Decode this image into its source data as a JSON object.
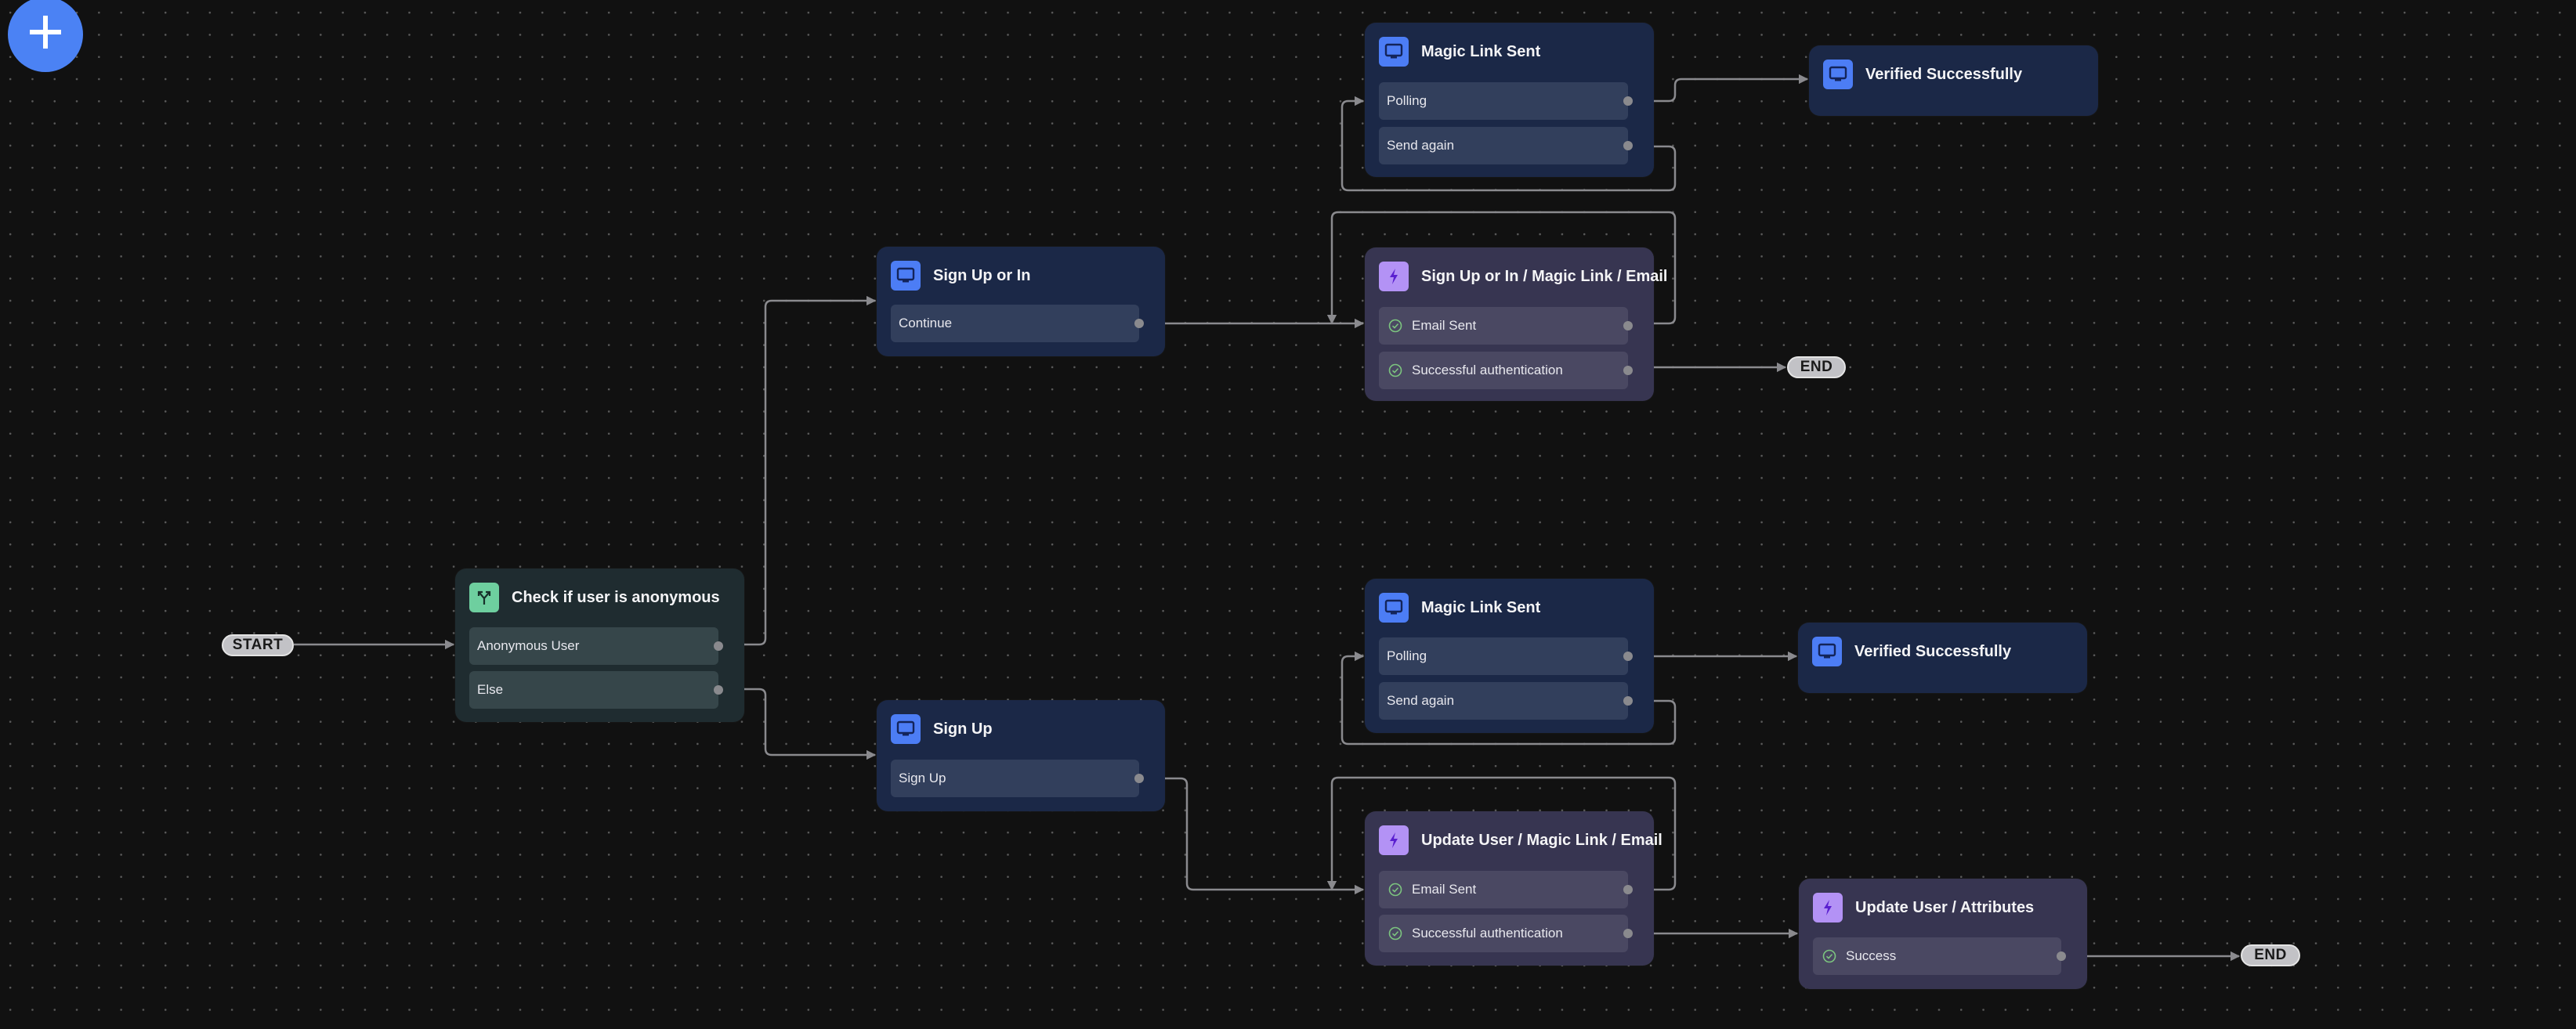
{
  "canvas": {
    "add_button_label": "+",
    "start_label": "START",
    "end_label": "END"
  },
  "colors": {
    "screen_accent": "#4c7df5",
    "action_accent": "#b392f5",
    "condition_accent": "#6ecf9f",
    "success_check": "#7cc47f",
    "edge": "#8a8a8e"
  },
  "nodes": {
    "check_anonymous": {
      "type": "condition",
      "icon": "split-icon",
      "title": "Check if user is anonymous",
      "rows": [
        {
          "label": "Anonymous User"
        },
        {
          "label": "Else"
        }
      ]
    },
    "sign_up_or_in": {
      "type": "screen",
      "icon": "screen-icon",
      "title": "Sign Up or In",
      "rows": [
        {
          "label": "Continue"
        }
      ]
    },
    "sign_up": {
      "type": "screen",
      "icon": "screen-icon",
      "title": "Sign Up",
      "rows": [
        {
          "label": "Sign Up"
        }
      ]
    },
    "magic_link_sent_top": {
      "type": "screen",
      "icon": "screen-icon",
      "title": "Magic Link Sent",
      "rows": [
        {
          "label": "Polling"
        },
        {
          "label": "Send again"
        }
      ]
    },
    "verified_top": {
      "type": "screen",
      "icon": "screen-icon",
      "title": "Verified Successfully",
      "rows": []
    },
    "signup_or_in_magic_email": {
      "type": "action",
      "icon": "bolt-icon",
      "title": "Sign Up or In / Magic Link / Email",
      "rows": [
        {
          "label": "Email Sent",
          "icon": "check-circle-icon"
        },
        {
          "label": "Successful authentication",
          "icon": "check-circle-icon"
        }
      ]
    },
    "magic_link_sent_bottom": {
      "type": "screen",
      "icon": "screen-icon",
      "title": "Magic Link Sent",
      "rows": [
        {
          "label": "Polling"
        },
        {
          "label": "Send again"
        }
      ]
    },
    "verified_bottom": {
      "type": "screen",
      "icon": "screen-icon",
      "title": "Verified Successfully",
      "rows": []
    },
    "update_user_magic_email": {
      "type": "action",
      "icon": "bolt-icon",
      "title": "Update User / Magic Link / Email",
      "rows": [
        {
          "label": "Email Sent",
          "icon": "check-circle-icon"
        },
        {
          "label": "Successful authentication",
          "icon": "check-circle-icon"
        }
      ]
    },
    "update_user_attributes": {
      "type": "action",
      "icon": "bolt-icon",
      "title": "Update User / Attributes",
      "rows": [
        {
          "label": "Success",
          "icon": "check-circle-icon"
        }
      ]
    }
  },
  "edges": [
    {
      "from": "START",
      "to": "Check if user is anonymous"
    },
    {
      "from": "Check if user is anonymous / Anonymous User",
      "to": "Sign Up or In"
    },
    {
      "from": "Check if user is anonymous / Else",
      "to": "Sign Up"
    },
    {
      "from": "Sign Up or In / Continue",
      "to": "Sign Up or In / Magic Link / Email"
    },
    {
      "from": "Sign Up or In / Magic Link / Email / Email Sent",
      "to": "Magic Link Sent (top)"
    },
    {
      "from": "Sign Up or In / Magic Link / Email / Successful authentication",
      "to": "END"
    },
    {
      "from": "Magic Link Sent (top) / Polling",
      "to": "Verified Successfully (top)"
    },
    {
      "from": "Magic Link Sent (top) / Send again",
      "to": "Sign Up or In / Magic Link / Email"
    },
    {
      "from": "Sign Up / Sign Up",
      "to": "Update User / Magic Link / Email"
    },
    {
      "from": "Update User / Magic Link / Email / Email Sent",
      "to": "Magic Link Sent (bottom)"
    },
    {
      "from": "Update User / Magic Link / Email / Successful authentication",
      "to": "Update User / Attributes"
    },
    {
      "from": "Magic Link Sent (bottom) / Polling",
      "to": "Verified Successfully (bottom)"
    },
    {
      "from": "Magic Link Sent (bottom) / Send again",
      "to": "Update User / Magic Link / Email"
    },
    {
      "from": "Update User / Attributes / Success",
      "to": "END"
    }
  ]
}
